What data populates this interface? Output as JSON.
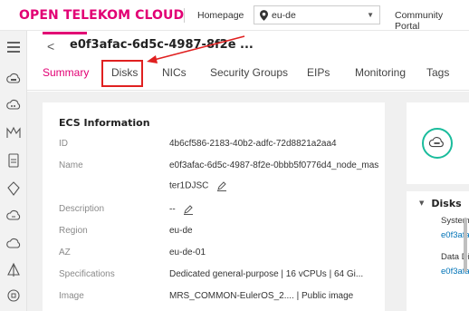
{
  "brand": {
    "name": "OPEN TELEKOM CLOUD",
    "color": "#e20074"
  },
  "topnav": {
    "home_label": "Homepage",
    "region_value": "eu-de",
    "community_label": "Community Portal"
  },
  "sidebar": {
    "items": [
      {
        "icon": "menu-icon"
      },
      {
        "icon": "cloud-server-icon"
      },
      {
        "icon": "cloud-storage-icon"
      },
      {
        "icon": "network-icon"
      },
      {
        "icon": "document-icon"
      },
      {
        "icon": "security-icon"
      },
      {
        "icon": "cloud-database-icon"
      },
      {
        "icon": "cloud-icon"
      },
      {
        "icon": "shield-icon"
      },
      {
        "icon": "settings-icon"
      }
    ]
  },
  "header": {
    "back_label": "<",
    "instance_title": "e0f3afac-6d5c-4987-8f2e ..."
  },
  "tabs": [
    {
      "label": "Summary",
      "active": true
    },
    {
      "label": "Disks",
      "active": false
    },
    {
      "label": "NICs",
      "active": false
    },
    {
      "label": "Security Groups",
      "active": false
    },
    {
      "label": "EIPs",
      "active": false
    },
    {
      "label": "Monitoring",
      "active": false
    },
    {
      "label": "Tags",
      "active": false
    }
  ],
  "ecs_info": {
    "title": "ECS Information",
    "rows": [
      {
        "label": "ID",
        "value": "4b6cf586-2183-40b2-adfc-72d8821a2aa4"
      },
      {
        "label": "Name",
        "value": "e0f3afac-6d5c-4987-8f2e-0bbb5f0776d4_node_mas",
        "value2": "ter1DJSC",
        "editable": true
      },
      {
        "label": "Description",
        "value": "--",
        "editable": true
      },
      {
        "label": "Region",
        "value": "eu-de"
      },
      {
        "label": "AZ",
        "value": "eu-de-01"
      },
      {
        "label": "Specifications",
        "value": "Dedicated general-purpose | 16 vCPUs | 64 Gi..."
      },
      {
        "label": "Image",
        "value": "MRS_COMMON-EulerOS_2.... | Public image"
      }
    ]
  },
  "disks_panel": {
    "title": "Disks",
    "system_label": "System",
    "system_link": "e0f3afa",
    "data_label": "Data Di",
    "data_link": "e0f3afa"
  },
  "colors": {
    "accent": "#e20074",
    "annotation": "#e02020",
    "link": "#0073b7",
    "teal": "#1abc9c"
  }
}
